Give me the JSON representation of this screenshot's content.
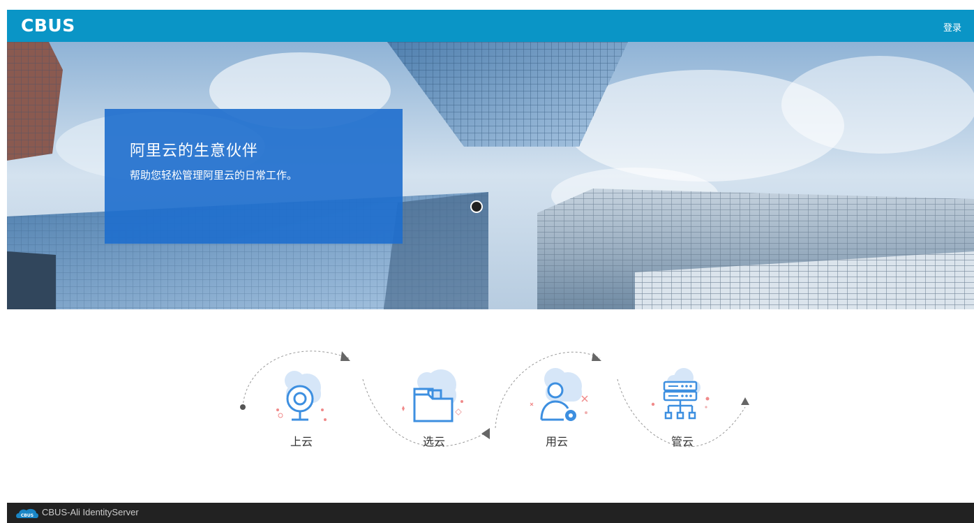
{
  "header": {
    "logo": "CBUS",
    "login_label": "登录"
  },
  "hero": {
    "title": "阿里云的生意伙伴",
    "subtitle": "帮助您轻松管理阿里云的日常工作。"
  },
  "steps": [
    {
      "label": "上云",
      "icon": "webcam-icon"
    },
    {
      "label": "选云",
      "icon": "folder-icon"
    },
    {
      "label": "用云",
      "icon": "user-settings-icon"
    },
    {
      "label": "管云",
      "icon": "server-icon"
    }
  ],
  "footer": {
    "badge": "CBUS",
    "text": "CBUS-Ali IdentityServer"
  },
  "colors": {
    "header": "#0a95c6",
    "promo": "#1e6ecd",
    "footer": "#222222",
    "icon_blue": "#3d8fe0",
    "icon_cloud": "#d6e6f8"
  }
}
